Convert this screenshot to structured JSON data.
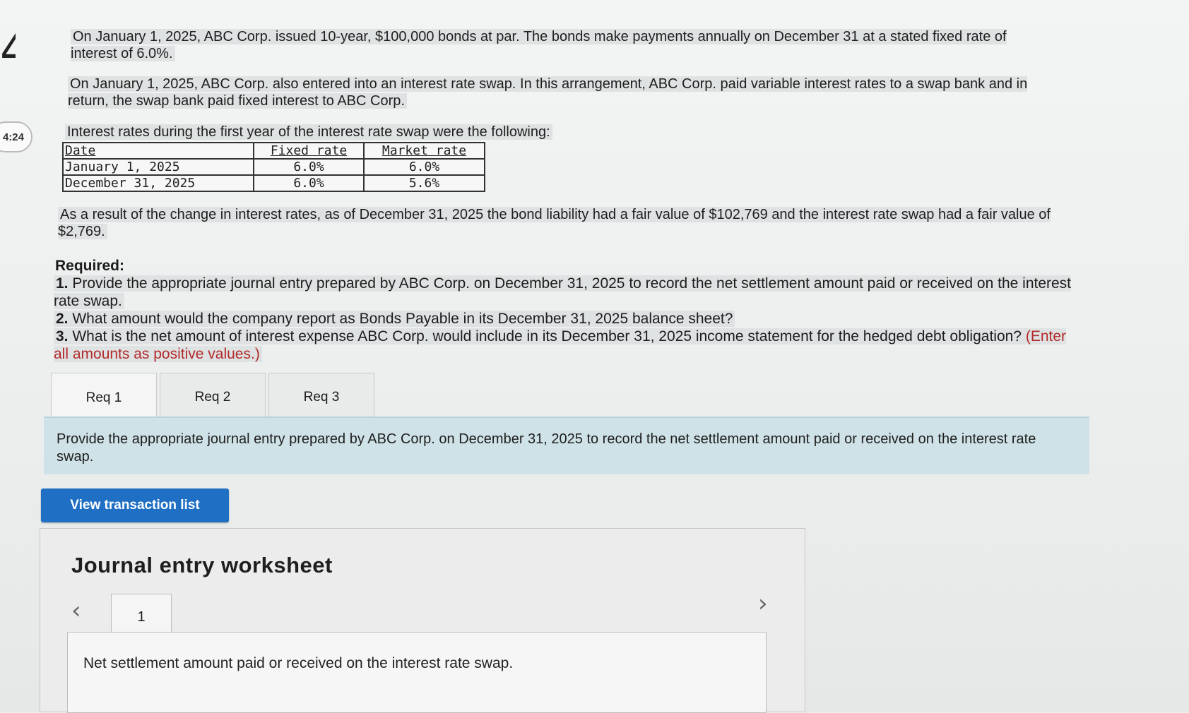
{
  "problem": {
    "p1": "On January 1, 2025, ABC Corp. issued 10-year, $100,000 bonds at par.  The bonds make payments annually on December 31 at a stated fixed rate of interest of 6.0%.",
    "p2": "On January 1, 2025, ABC Corp. also entered into an interest rate swap.  In this arrangement, ABC Corp. paid variable interest rates to a swap bank and in return, the swap bank paid fixed interest to ABC Corp.",
    "p3": "Interest rates during the first year of the interest rate swap were the following:",
    "table": {
      "headers": [
        "Date",
        "Fixed rate",
        "Market rate"
      ],
      "rows": [
        [
          "January 1, 2025",
          "6.0%",
          "6.0%"
        ],
        [
          "December 31, 2025",
          "6.0%",
          "5.6%"
        ]
      ]
    },
    "p4": "As a result of the change in interest rates, as of December 31, 2025 the bond liability had a fair value of $102,769 and the interest rate swap had a fair value of $2,769."
  },
  "required": {
    "title": "Required:",
    "items": [
      {
        "num": "1.",
        "text": "Provide the appropriate journal entry prepared by ABC Corp. on December 31, 2025 to record the net settlement amount paid or received on the interest rate swap."
      },
      {
        "num": "2.",
        "text": "What amount would the company report as Bonds Payable in its December 31, 2025 balance sheet?"
      },
      {
        "num": "3.",
        "text": "What is the net amount of interest expense ABC Corp. would include in its December 31, 2025 income statement for the hedged debt obligation?"
      }
    ],
    "note": "(Enter all amounts as positive values.)"
  },
  "timer": "4:24",
  "tabs": [
    "Req 1",
    "Req 2",
    "Req 3"
  ],
  "prompt": "Provide the appropriate journal entry prepared by ABC Corp. on December 31, 2025 to record the net settlement amount paid or received on the interest rate swap.",
  "view_button": "View transaction list",
  "worksheet": {
    "title": "Journal entry worksheet",
    "page": "1",
    "entry_description": "Net settlement amount paid or received on the interest rate swap."
  },
  "colors": {
    "accent_button": "#1f6fc5",
    "prompt_bg": "#cfe2e8",
    "note_red": "#b22a2a"
  },
  "icons": {
    "prev": "chevron-left-icon",
    "next": "chevron-right-icon"
  }
}
